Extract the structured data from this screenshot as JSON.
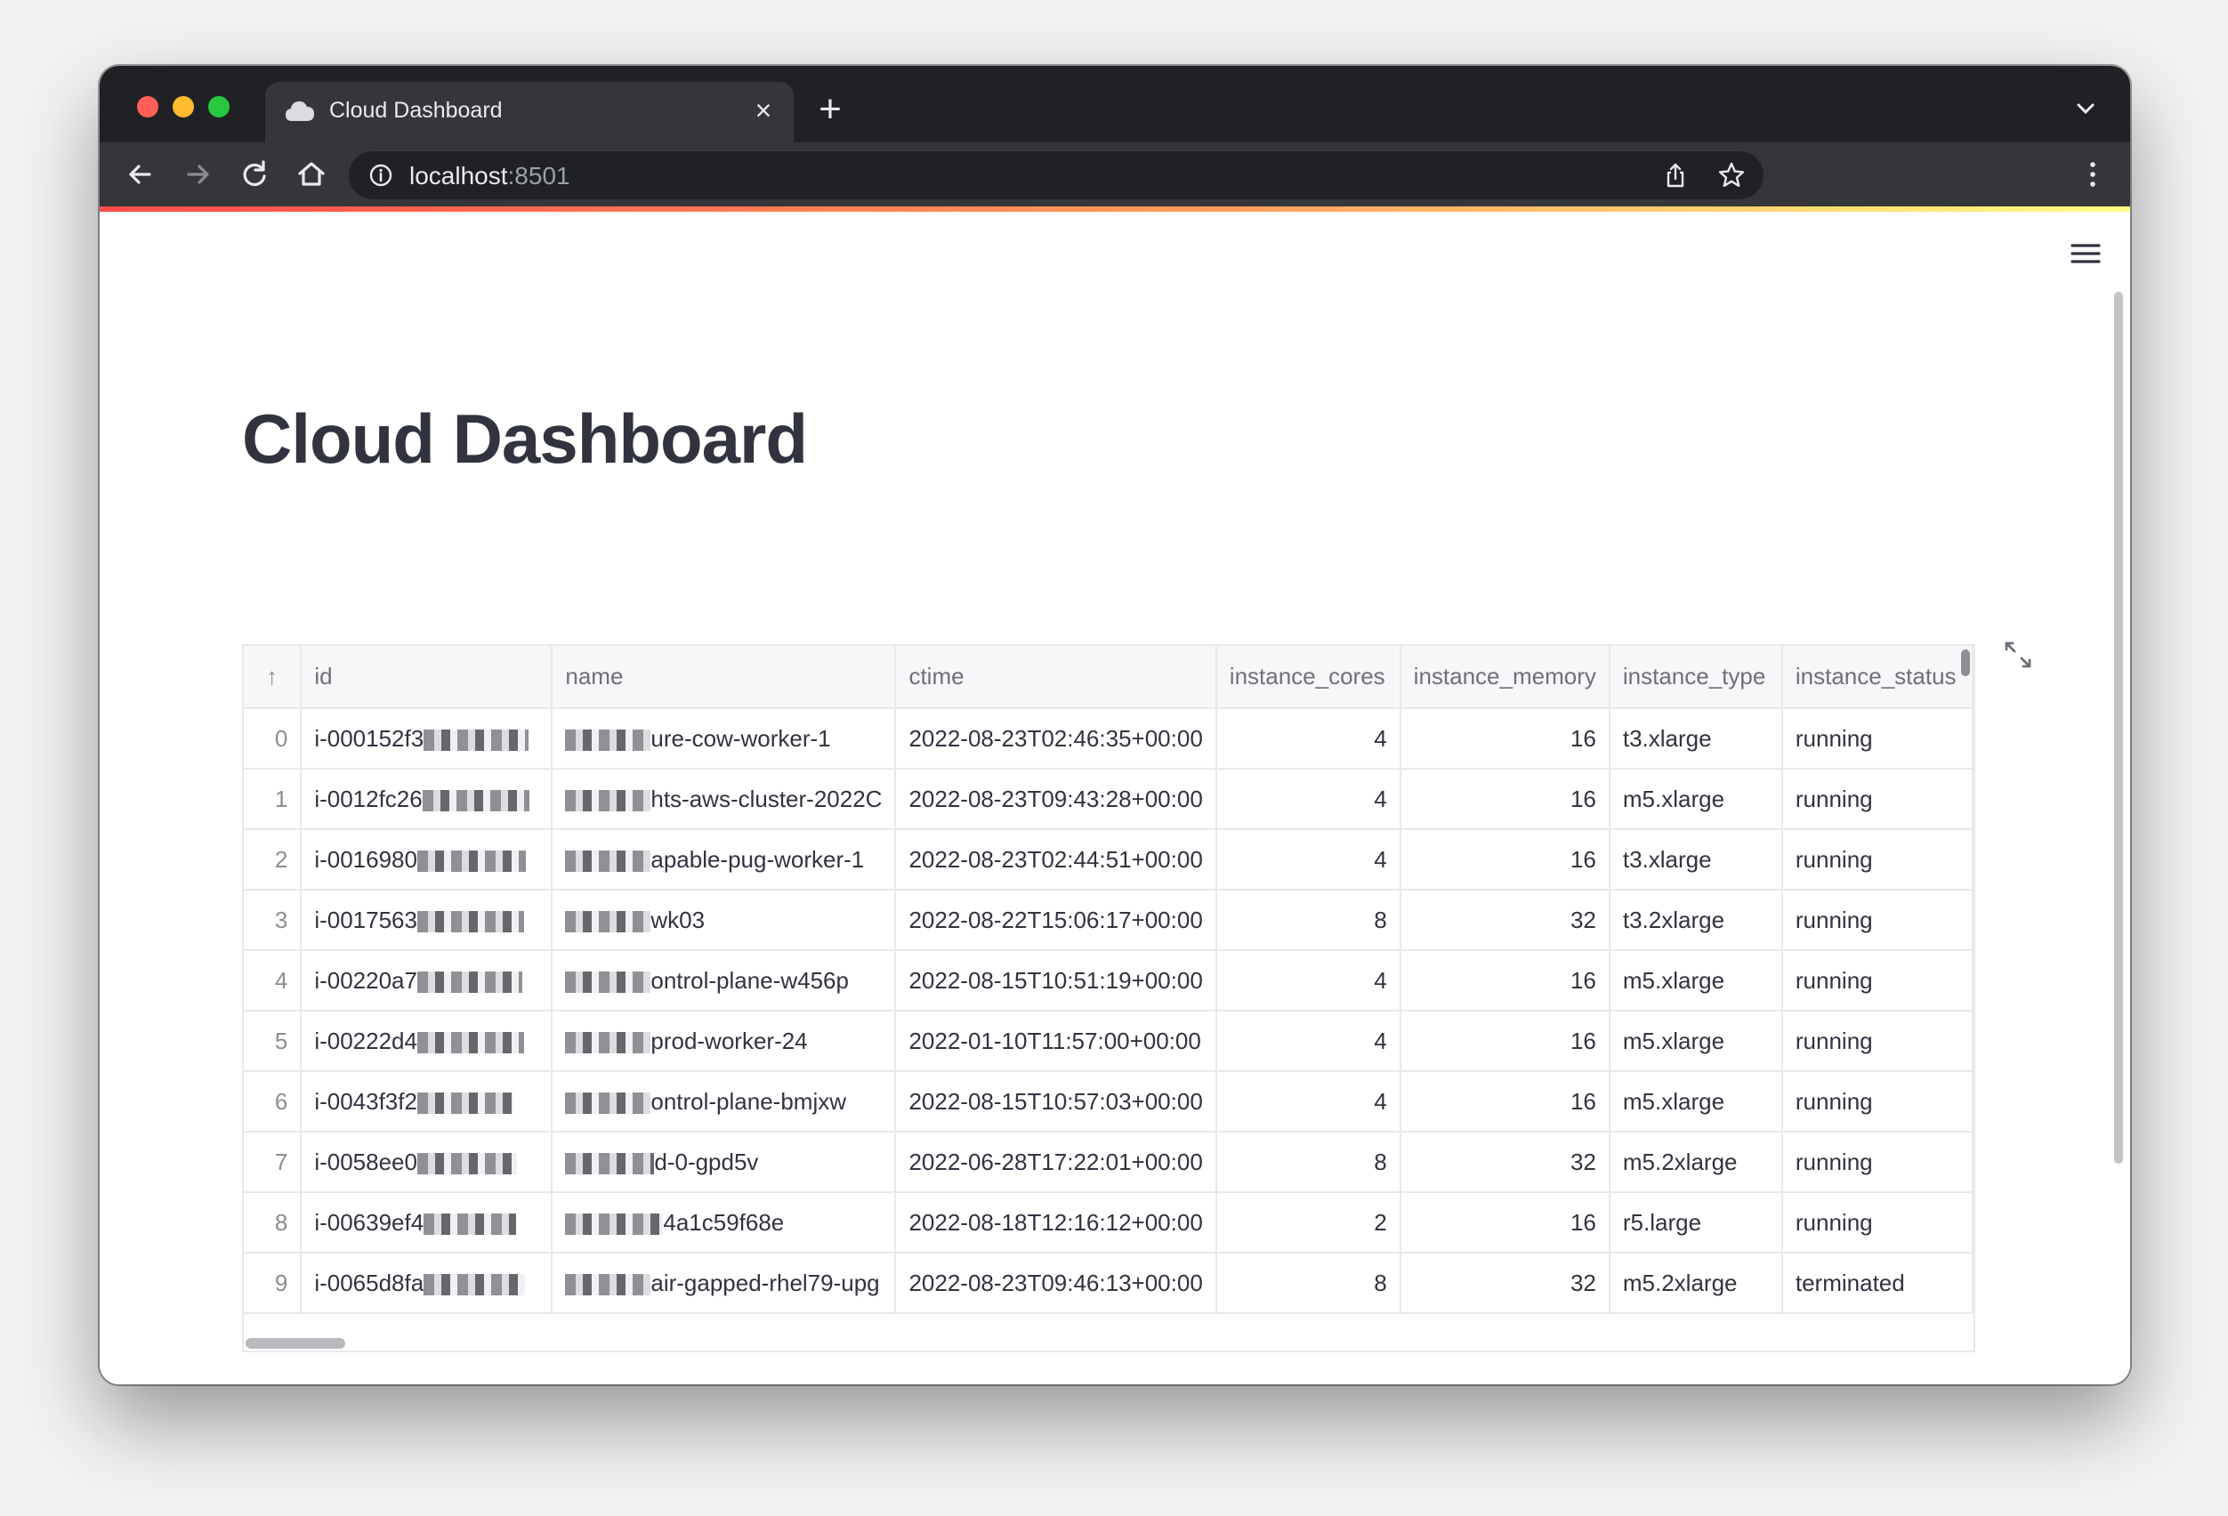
{
  "browser": {
    "tab_title": "Cloud Dashboard",
    "url_host": "localhost",
    "url_port": ":8501"
  },
  "page": {
    "title": "Cloud Dashboard"
  },
  "table": {
    "index_header": "↑",
    "columns": [
      "id",
      "name",
      "ctime",
      "instance_cores",
      "instance_memory",
      "instance_type",
      "instance_status"
    ],
    "rows": [
      {
        "idx": "0",
        "id": "i-000152f3",
        "name": "ure-cow-worker-1",
        "ctime": "2022-08-23T02:46:35+00:00",
        "cores": "4",
        "memory": "16",
        "type": "t3.xlarge",
        "status": "running"
      },
      {
        "idx": "1",
        "id": "i-0012fc26",
        "name": "hts-aws-cluster-2022C",
        "ctime": "2022-08-23T09:43:28+00:00",
        "cores": "4",
        "memory": "16",
        "type": "m5.xlarge",
        "status": "running"
      },
      {
        "idx": "2",
        "id": "i-0016980",
        "name": "apable-pug-worker-1",
        "ctime": "2022-08-23T02:44:51+00:00",
        "cores": "4",
        "memory": "16",
        "type": "t3.xlarge",
        "status": "running"
      },
      {
        "idx": "3",
        "id": "i-0017563",
        "name": "wk03",
        "ctime": "2022-08-22T15:06:17+00:00",
        "cores": "8",
        "memory": "32",
        "type": "t3.2xlarge",
        "status": "running"
      },
      {
        "idx": "4",
        "id": "i-00220a7",
        "name": "ontrol-plane-w456p",
        "ctime": "2022-08-15T10:51:19+00:00",
        "cores": "4",
        "memory": "16",
        "type": "m5.xlarge",
        "status": "running"
      },
      {
        "idx": "5",
        "id": "i-00222d4",
        "name": "prod-worker-24",
        "ctime": "2022-01-10T11:57:00+00:00",
        "cores": "4",
        "memory": "16",
        "type": "m5.xlarge",
        "status": "running"
      },
      {
        "idx": "6",
        "id": "i-0043f3f2",
        "name": "ontrol-plane-bmjxw",
        "ctime": "2022-08-15T10:57:03+00:00",
        "cores": "4",
        "memory": "16",
        "type": "m5.xlarge",
        "status": "running"
      },
      {
        "idx": "7",
        "id": "i-0058ee0",
        "name": "d-0-gpd5v",
        "ctime": "2022-06-28T17:22:01+00:00",
        "cores": "8",
        "memory": "32",
        "type": "m5.2xlarge",
        "status": "running"
      },
      {
        "idx": "8",
        "id": "i-00639ef4",
        "name": "4a1c59f68e",
        "ctime": "2022-08-18T12:16:12+00:00",
        "cores": "2",
        "memory": "16",
        "type": "r5.large",
        "status": "running"
      },
      {
        "idx": "9",
        "id": "i-0065d8fa",
        "name": "air-gapped-rhel79-upg",
        "ctime": "2022-08-23T09:46:13+00:00",
        "cores": "8",
        "memory": "32",
        "type": "m5.2xlarge",
        "status": "terminated"
      }
    ]
  },
  "icons": {
    "tab": "cloud-icon",
    "back": "back-arrow-icon",
    "forward": "forward-arrow-icon",
    "reload": "reload-icon",
    "home": "home-icon",
    "info": "info-icon",
    "share": "share-icon",
    "bookmark": "star-icon",
    "menu": "kebab-menu-icon",
    "app_menu": "hamburger-icon",
    "fullscreen": "expand-icon"
  },
  "colors": {
    "title_text": "#31333f",
    "accent_start": "#ff4b4b",
    "accent_end": "#fffd80",
    "chrome_dark": "#202124",
    "chrome_toolbar": "#35363a"
  }
}
